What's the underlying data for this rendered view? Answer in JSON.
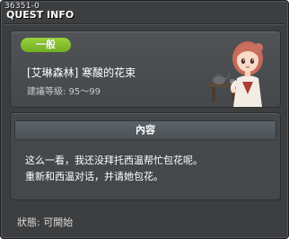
{
  "window": {
    "quest_id": "36351-0",
    "title": "QUEST INFO"
  },
  "quest": {
    "type_badge": "一般",
    "name": "[艾琳森林] 寒酸的花束",
    "level_requirement": "建議等級: 95～99",
    "npc_portrait": "npc-portrait-icon"
  },
  "content": {
    "header": "內容",
    "lines": [
      "这么一看，我还没拜托西温帮忙包花呢。",
      "重新和西温对话，并请她包花。"
    ]
  },
  "status": {
    "text": "狀態: 可開始"
  },
  "colors": {
    "window_bg": "#3c3e40",
    "badge_green": "#86c22c",
    "content_header": "#555c61"
  }
}
